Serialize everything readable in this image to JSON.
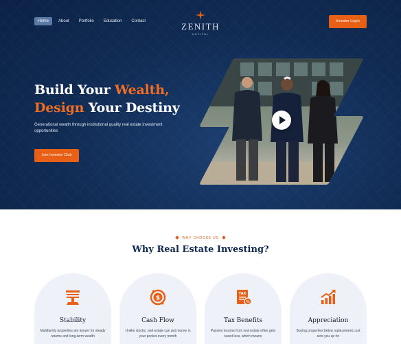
{
  "nav": {
    "items": [
      {
        "label": "Home",
        "active": true
      },
      {
        "label": "About",
        "active": false
      },
      {
        "label": "Portfolio",
        "active": false
      },
      {
        "label": "Education",
        "active": false
      },
      {
        "label": "Contact",
        "active": false
      }
    ]
  },
  "logo": {
    "name": "ZENITH",
    "sub": "CAPITAL",
    "icon": "four-point-star-icon"
  },
  "header": {
    "login_label": "Investor Login"
  },
  "hero": {
    "headline_word_1": "Build Your ",
    "headline_accent_1": "Wealth,",
    "headline_accent_2": "Design",
    "headline_word_2": " Your Destiny",
    "subtext": "Generational wealth through institutional quality real estate investment opportunities",
    "cta_label": "Join Investor Club",
    "video_icon": "play-icon"
  },
  "why": {
    "eyebrow": "WHY CHOOSE US",
    "title": "Why Real Estate Investing?",
    "cards": [
      {
        "title": "Stability",
        "text": "Multifamily properties are known for steady returns and long-term wealth",
        "icon": "balance-icon"
      },
      {
        "title": "Cash Flow",
        "text": "Unlike stocks, real estate can put money in your pocket every month",
        "icon": "dollar-coin-icon"
      },
      {
        "title": "Tax Benefits",
        "text": "Passive income from real estate often gets taxed less, which means",
        "icon": "tax-document-icon"
      },
      {
        "title": "Appreciation",
        "text": "Buying properties below replacement cost sets you up for",
        "icon": "growth-chart-icon"
      }
    ]
  },
  "colors": {
    "navy": "#102b53",
    "accent": "#e85f16",
    "card_bg": "#eef2f8"
  }
}
